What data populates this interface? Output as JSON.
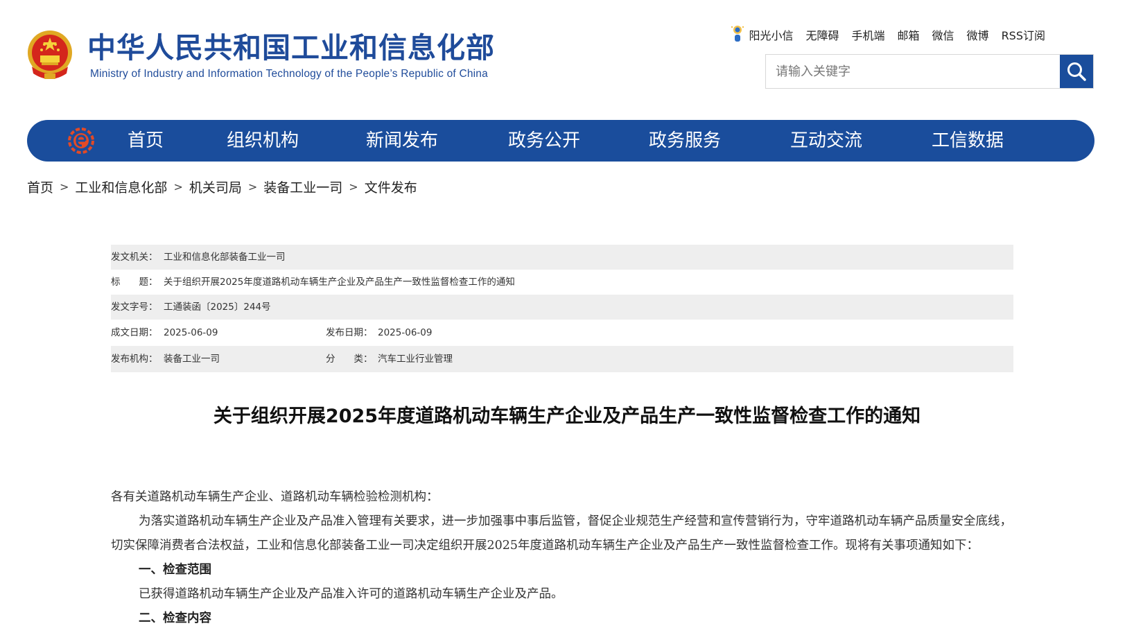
{
  "header": {
    "title_cn": "中华人民共和国工业和信息化部",
    "title_en": "Ministry of Industry and Information Technology of the People’s Republic of China",
    "toplinks": [
      "阳光小信",
      "无障碍",
      "手机端",
      "邮箱",
      "微信",
      "微博",
      "RSS订阅"
    ],
    "search_placeholder": "请输入关键字"
  },
  "nav": {
    "items": [
      "首页",
      "组织机构",
      "新闻发布",
      "政务公开",
      "政务服务",
      "互动交流",
      "工信数据"
    ]
  },
  "breadcrumb": [
    "首页",
    "工业和信息化部",
    "机关司局",
    "装备工业一司",
    "文件发布"
  ],
  "meta": {
    "issuer_label": "发文机关：",
    "issuer": "工业和信息化部装备工业一司",
    "title_label": "标　　题：",
    "title": "关于组织开展2025年度道路机动车辆生产企业及产品生产一致性监督检查工作的通知",
    "docno_label": "发文字号：",
    "docno": "工通装函〔2025〕244号",
    "written_label": "成文日期：",
    "written": "2025-06-09",
    "published_label": "发布日期：",
    "published": "2025-06-09",
    "org_label": "发布机构：",
    "org": "装备工业一司",
    "category_label": "分　　类：",
    "category": "汽车工业行业管理"
  },
  "article": {
    "title": "关于组织开展2025年度道路机动车辆生产企业及产品生产一致性监督检查工作的通知",
    "greeting": "各有关道路机动车辆生产企业、道路机动车辆检验检测机构：",
    "intro": "为落实道路机动车辆生产企业及产品准入管理有关要求，进一步加强事中事后监管，督促企业规范生产经营和宣传营销行为，守牢道路机动车辆产品质量安全底线，切实保障消费者合法权益，工业和信息化部装备工业一司决定组织开展2025年度道路机动车辆生产企业及产品生产一致性监督检查工作。现将有关事项通知如下：",
    "section1_title": "一、检查范围",
    "section1_text": "已获得道路机动车辆生产企业及产品准入许可的道路机动车辆生产企业及产品。",
    "section2_title": "二、检查内容"
  }
}
